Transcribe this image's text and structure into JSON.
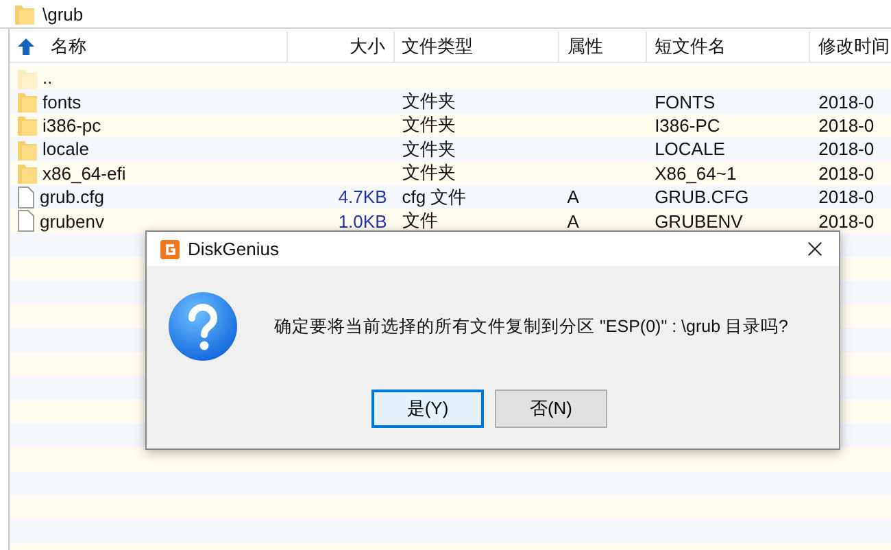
{
  "path_bar": {
    "path": "\\grub"
  },
  "table": {
    "columns": [
      {
        "label": "名称"
      },
      {
        "label": "大小"
      },
      {
        "label": "文件类型"
      },
      {
        "label": "属性"
      },
      {
        "label": "短文件名"
      },
      {
        "label": "修改时间"
      }
    ],
    "rows": [
      {
        "kind": "parent",
        "name": ".."
      },
      {
        "kind": "folder",
        "name": "fonts",
        "type": "文件夹",
        "short_name": "FONTS",
        "modified": "2018-0"
      },
      {
        "kind": "folder",
        "name": "i386-pc",
        "type": "文件夹",
        "short_name": "I386-PC",
        "modified": "2018-0"
      },
      {
        "kind": "folder",
        "name": "locale",
        "type": "文件夹",
        "short_name": "LOCALE",
        "modified": "2018-0"
      },
      {
        "kind": "folder",
        "name": "x86_64-efi",
        "type": "文件夹",
        "short_name": "X86_64~1",
        "modified": "2018-0"
      },
      {
        "kind": "file",
        "name": "grub.cfg",
        "size": "4.7KB",
        "type": "cfg 文件",
        "attributes": "A",
        "short_name": "GRUB.CFG",
        "modified": "2018-0"
      },
      {
        "kind": "file",
        "name": "grubenv",
        "size": "1.0KB",
        "type": "文件",
        "attributes": "A",
        "short_name": "GRUBENV",
        "modified": "2018-0"
      }
    ]
  },
  "dialog": {
    "title": "DiskGenius",
    "message": "确定要将当前选择的所有文件复制到分区 \"ESP(0)\" : \\grub 目录吗?",
    "buttons": [
      {
        "label": "是(Y)",
        "selected": true
      },
      {
        "label": "否(N)",
        "selected": false
      }
    ]
  }
}
